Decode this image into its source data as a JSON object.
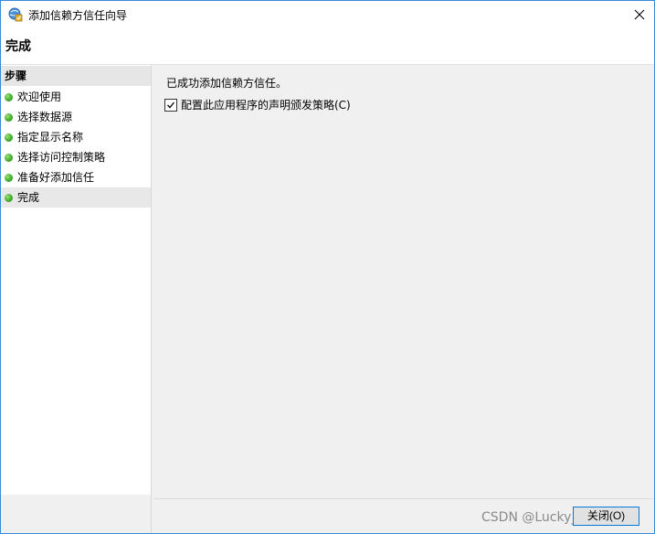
{
  "window": {
    "title": "添加信赖方信任向导",
    "icon": "wizard-app-icon",
    "close_icon": "close-icon"
  },
  "header": {
    "title": "完成"
  },
  "sidebar": {
    "steps_header": "步骤",
    "items": [
      {
        "label": "欢迎使用",
        "status": "completed"
      },
      {
        "label": "选择数据源",
        "status": "completed"
      },
      {
        "label": "指定显示名称",
        "status": "completed"
      },
      {
        "label": "选择访问控制策略",
        "status": "completed"
      },
      {
        "label": "准备好添加信任",
        "status": "completed"
      },
      {
        "label": "完成",
        "status": "current"
      }
    ],
    "status_color": "#3fae2a"
  },
  "content": {
    "message": "已成功添加信赖方信任。",
    "checkbox": {
      "label": "配置此应用程序的声明颁发策略(C)",
      "checked": true
    }
  },
  "footer": {
    "close_label": "关闭(O)"
  },
  "watermark": "CSDN @Lucky_Nicky.",
  "colors": {
    "accent": "#0078d7",
    "window_border": "#3a8bd6",
    "panel_bg": "#f0f0f0"
  }
}
